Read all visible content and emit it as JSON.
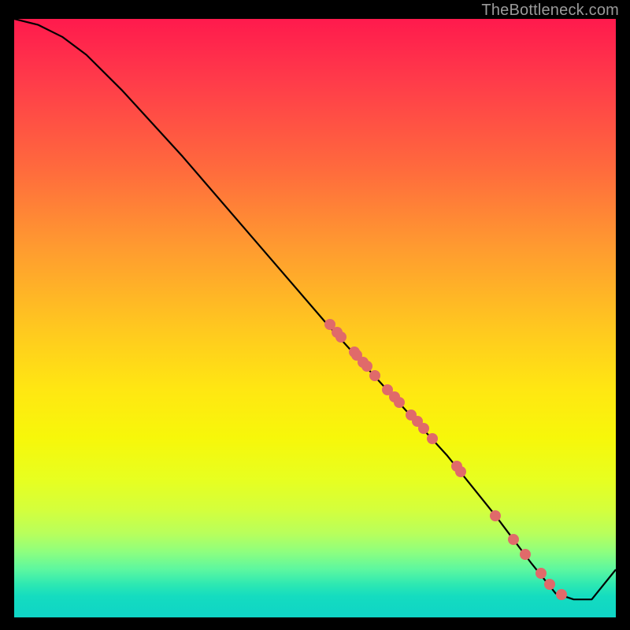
{
  "watermark": "TheBottleneck.com",
  "chart_data": {
    "type": "line",
    "title": "",
    "xlabel": "",
    "ylabel": "",
    "xlim": [
      0,
      100
    ],
    "ylim": [
      0,
      100
    ],
    "curve": {
      "name": "bottleneck-curve",
      "x": [
        0,
        4,
        8,
        12,
        18,
        28,
        40,
        52,
        62,
        72,
        80,
        86,
        90,
        93,
        96,
        100
      ],
      "y": [
        100,
        99,
        97,
        94,
        88,
        77,
        63,
        49,
        38,
        27,
        17,
        9,
        4,
        3,
        3,
        8
      ]
    },
    "points": {
      "name": "sample-markers",
      "color": "#e06a6a",
      "xy": [
        [
          52.5,
          49.0
        ],
        [
          53.7,
          47.6
        ],
        [
          54.3,
          46.9
        ],
        [
          56.5,
          44.4
        ],
        [
          57.0,
          43.8
        ],
        [
          58.0,
          42.6
        ],
        [
          58.6,
          42.0
        ],
        [
          60.0,
          40.4
        ],
        [
          62.0,
          38.0
        ],
        [
          63.2,
          36.8
        ],
        [
          64.0,
          35.9
        ],
        [
          66.0,
          33.8
        ],
        [
          67.0,
          32.7
        ],
        [
          68.0,
          31.6
        ],
        [
          69.5,
          29.9
        ],
        [
          73.5,
          25.2
        ],
        [
          74.2,
          24.4
        ],
        [
          80.0,
          17.0
        ],
        [
          83.0,
          13.0
        ],
        [
          85.0,
          10.5
        ],
        [
          87.5,
          7.4
        ],
        [
          89.0,
          5.5
        ],
        [
          91.0,
          3.8
        ]
      ]
    }
  },
  "colors": {
    "marker": "#e06a6a",
    "curve": "#000000",
    "watermark": "#9a9a9a"
  }
}
